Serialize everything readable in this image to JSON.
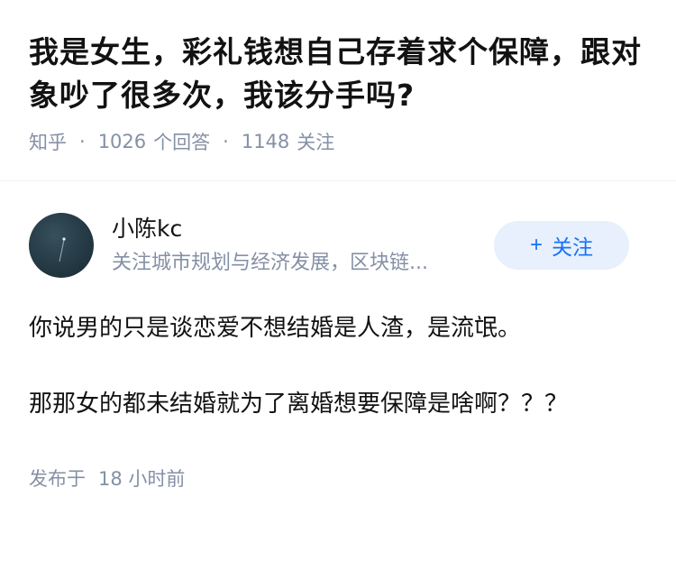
{
  "question": {
    "title": "我是女生，彩礼钱想自己存着求个保障，跟对象吵了很多次，我该分手吗?",
    "source": "知乎",
    "answer_count": "1026",
    "answer_label": "个回答",
    "follower_count": "1148",
    "follower_label": "关注",
    "separator": "·"
  },
  "answer": {
    "author_name": "小陈kc",
    "author_bio": "关注城市规划与经济发展，区块链...",
    "follow_button": {
      "icon": "plus-icon",
      "label": "关注"
    },
    "paragraphs": [
      "你说男的只是谈恋爱不想结婚是人渣，是流氓。",
      "那那女的都未结婚就为了离婚想要保障是啥啊？？？"
    ],
    "publish_label": "发布于",
    "publish_time": "18 小时前"
  },
  "colors": {
    "text": "#121212",
    "meta": "#8590a6",
    "accent": "#1772f6",
    "accent_bg": "#e7f0fc"
  }
}
